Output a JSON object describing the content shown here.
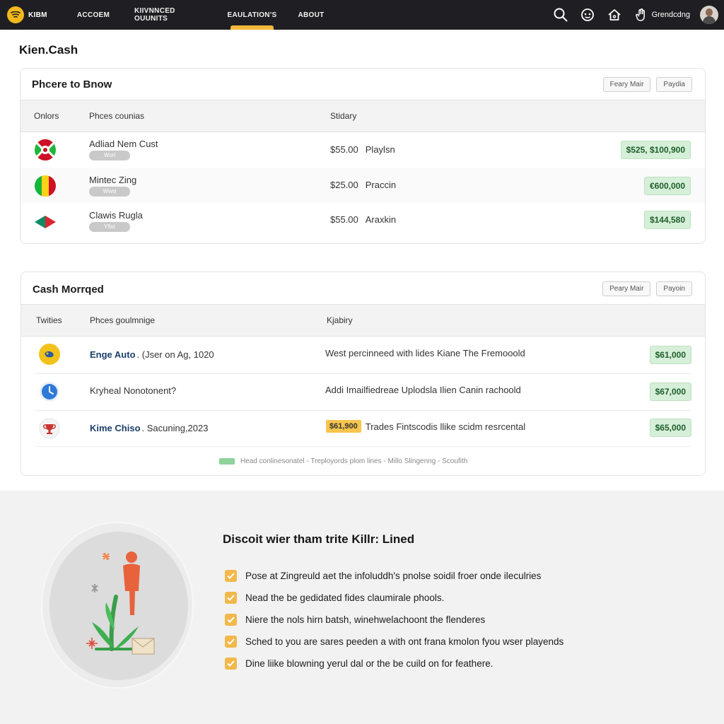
{
  "nav": {
    "brand": "KIBM",
    "items": [
      {
        "label": "ACCOEM"
      },
      {
        "label": "KIIVNNCED OUUNITS"
      },
      {
        "label": "EAULATION'S"
      },
      {
        "label": "ABOUT"
      }
    ],
    "user": "Grendcdng"
  },
  "app_title": "Kien.Cash",
  "card1": {
    "title": "Phcere to Bnow",
    "buttons": [
      "Feary Mair",
      "Paydia"
    ],
    "headers": [
      "Onlors",
      "Phces counias",
      "Stidary"
    ],
    "rows": [
      {
        "name": "Adliad Nem Cust",
        "pill": "Worl",
        "price": "$55.00",
        "status": "Playlsn",
        "amount": "$525, $100,900"
      },
      {
        "name": "Mintec Zing",
        "pill": "Wwsi",
        "price": "$25.00",
        "status": "Praccin",
        "amount": "€600,000"
      },
      {
        "name": "Clawis Rugla",
        "pill": "Yfisr",
        "price": "$55.00",
        "status": "Araxkin",
        "amount": "$144,580"
      }
    ]
  },
  "card2": {
    "title": "Cash Morrqed",
    "buttons": [
      "Peary Mair",
      "Payoin"
    ],
    "headers": [
      "Twities",
      "Phces goulmnige",
      "Kjabiry"
    ],
    "rows": [
      {
        "name": "Enge Auto",
        "sub": ". (Jser on Ag, 1020",
        "desc": "West percinneed with lides Kiane The Fremooold",
        "highlight": "",
        "amount": "$61,000"
      },
      {
        "name": "",
        "sub": "Kryheal Nonotonent?",
        "desc": "Addi Imailfiedreae Uplodsla Ilien Canin rachoold",
        "highlight": "",
        "amount": "$67,000"
      },
      {
        "name": "Kime Chiso",
        "sub": ". Sacuning,2023",
        "desc": "Trades Fintscodis llike scidm resrcental",
        "highlight": "$61,900",
        "amount": "$65,000"
      }
    ],
    "legend": "Head conlinesonatel - Treployords plom lines - Millo Slingenng - Scoufith"
  },
  "discover": {
    "title": "Discoit wier tham trite Killr: Lined",
    "items": [
      "Pose at Zingreuld aet the infoluddh's pnolse soidil froer onde ileculries",
      "Nead the be gedidated fides claumirale phools.",
      "Niere the nols hirn batsh, winehwelachoont the flenderes",
      "Sched to you are sares peeden a with ont frana kmolon fyou wser playends",
      "Dine liike blowning yerul dal or the be cuild on for feathere."
    ]
  },
  "colors": {
    "accent": "#f1b93a",
    "nav_bg": "#1f1f23",
    "money_bg": "#d6efd8",
    "check": "#f2b84a"
  }
}
